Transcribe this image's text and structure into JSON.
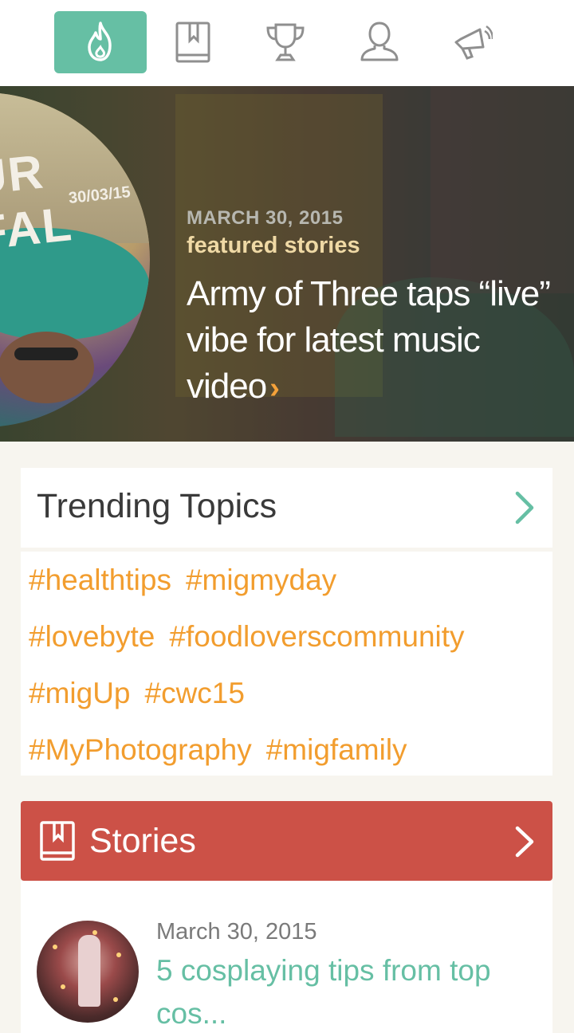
{
  "nav": {
    "items": [
      {
        "name": "flame-icon",
        "active": true
      },
      {
        "name": "book-icon",
        "active": false
      },
      {
        "name": "trophy-icon",
        "active": false
      },
      {
        "name": "user-icon",
        "active": false
      },
      {
        "name": "megaphone-icon",
        "active": false
      }
    ]
  },
  "hero": {
    "image_text": "UR FAL",
    "image_date_text": "30/03/15",
    "date": "MARCH 30, 2015",
    "category": "featured stories",
    "title": "Army of Three taps “live” vibe for latest music video",
    "arrow": "›",
    "pagination": {
      "count": 5,
      "active_index": 1
    }
  },
  "trending": {
    "title": "Trending Topics",
    "tag_rows": [
      [
        "#healthtips",
        "#migmyday"
      ],
      [
        "#lovebyte",
        "#foodloverscommunity"
      ],
      [
        "#migUp",
        "#cwc15"
      ],
      [
        "#MyPhotography",
        "#migfamily"
      ]
    ]
  },
  "stories": {
    "label": "Stories",
    "items": [
      {
        "date": "March 30, 2015",
        "title": "5 cosplaying tips from top cos..."
      }
    ]
  },
  "colors": {
    "accent_green": "#66bfa4",
    "accent_orange": "#f29d2e",
    "stories_red": "#cc5147"
  }
}
